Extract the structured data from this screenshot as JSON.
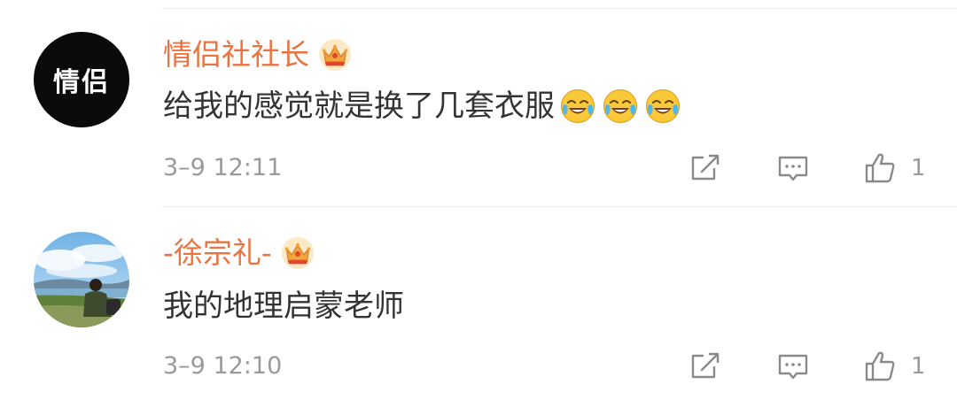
{
  "comments": [
    {
      "avatar_text": "情侣",
      "username": "情侣社社长",
      "content": "给我的感觉就是换了几套衣服",
      "emojis": [
        "laugh-cry",
        "laugh-cry",
        "laugh-cry"
      ],
      "timestamp": "3–9 12:11",
      "like_count": "1"
    },
    {
      "avatar_text": "",
      "username": "-徐宗礼-",
      "content": "我的地理启蒙老师",
      "emojis": [],
      "timestamp": "3–9 12:10",
      "like_count": "1"
    }
  ],
  "icons": {
    "crown": "crown-vip-icon",
    "share": "share-icon",
    "reply": "comment-icon",
    "like": "thumbs-up-icon",
    "emoji": "laugh-cry-emoji-icon"
  },
  "colors": {
    "username": "#eb7340",
    "content": "#333333",
    "meta": "#9a9a9a",
    "icon": "#8a8a8a",
    "divider": "#ececec"
  }
}
